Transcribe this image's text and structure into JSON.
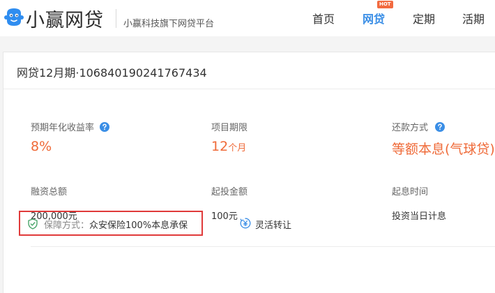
{
  "header": {
    "brand": "小赢网贷",
    "subtitle": "小赢科技旗下网贷平台",
    "nav": [
      {
        "label": "首页"
      },
      {
        "label": "网贷",
        "badge": "HOT",
        "active": true
      },
      {
        "label": "定期"
      },
      {
        "label": "活期"
      }
    ],
    "icons": {
      "logo": "mascot-logo-icon"
    }
  },
  "card": {
    "title": "网贷12月期·106840190241767434",
    "stats": {
      "rate": {
        "label": "预期年化收益率",
        "value": "8%",
        "help_icon": "question-icon"
      },
      "term": {
        "label": "项目期限",
        "value": "12",
        "unit": "个月"
      },
      "repay": {
        "label": "还款方式",
        "value": "等额本息(气球贷)",
        "help_icon": "question-icon"
      },
      "total": {
        "label": "融资总额",
        "value": "200,000元"
      },
      "min_invest": {
        "label": "起投金额",
        "value": "100元"
      },
      "interest_start": {
        "label": "起息时间",
        "value": "投资当日计息"
      }
    },
    "guarantee": {
      "key": "保障方式：",
      "value": "众安保险100%本息承保",
      "icon": "shield-icon"
    },
    "transfer": {
      "label": "灵活转让",
      "icon": "yen-transfer-icon"
    }
  },
  "colors": {
    "accent": "#3a8ee6",
    "highlight": "#ef6a38",
    "badge": "#f26a3f",
    "box_border": "#e03a3a",
    "shield": "#4aa56a"
  }
}
